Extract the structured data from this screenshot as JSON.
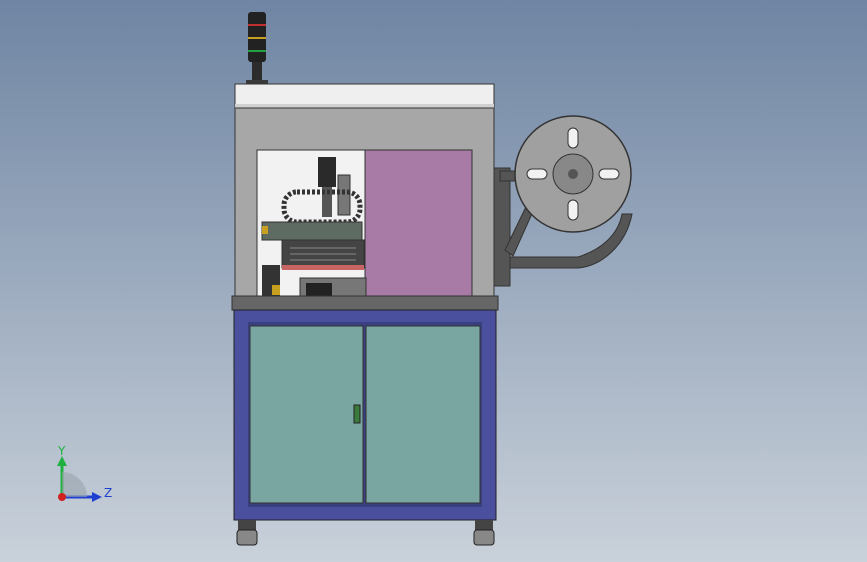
{
  "viewport": {
    "background_top": "#6f85a3",
    "background_bottom": "#c9d1da"
  },
  "machine": {
    "frame_color": "#4a4f9e",
    "cabinet_door_color": "#7aa6a1",
    "upper_panel_color": "#a7a7a7",
    "top_cap_color": "#efefef",
    "magenta_panel_color": "#a77ba5",
    "dark_metal_color": "#555555"
  },
  "triad": {
    "y_label": "Y",
    "z_label": "Z",
    "y_color": "#20b040",
    "z_color": "#2040d0",
    "x_color": "#d02020"
  }
}
